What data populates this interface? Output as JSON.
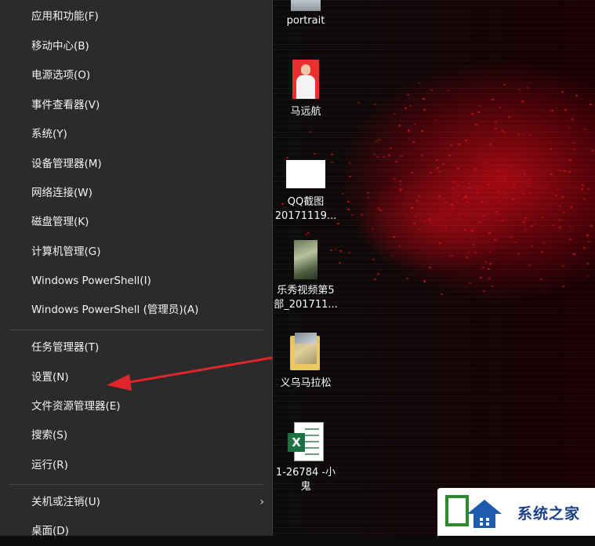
{
  "menu": {
    "items": [
      {
        "label": "应用和功能(F)"
      },
      {
        "label": "移动中心(B)"
      },
      {
        "label": "电源选项(O)"
      },
      {
        "label": "事件查看器(V)"
      },
      {
        "label": "系统(Y)"
      },
      {
        "label": "设备管理器(M)"
      },
      {
        "label": "网络连接(W)"
      },
      {
        "label": "磁盘管理(K)"
      },
      {
        "label": "计算机管理(G)"
      },
      {
        "label": "Windows PowerShell(I)"
      },
      {
        "label": "Windows PowerShell (管理员)(A)"
      },
      {
        "label": "任务管理器(T)"
      },
      {
        "label": "设置(N)"
      },
      {
        "label": "文件资源管理器(E)"
      },
      {
        "label": "搜索(S)"
      },
      {
        "label": "运行(R)"
      },
      {
        "label": "关机或注销(U)"
      },
      {
        "label": "桌面(D)"
      }
    ],
    "submenu_arrow": "›"
  },
  "desktop": {
    "icons": [
      {
        "label": "portrait"
      },
      {
        "label": "马远航"
      },
      {
        "label": "QQ截图\n20171119..."
      },
      {
        "label": "乐秀视频第5\n部_201711..."
      },
      {
        "label": "义乌马拉松"
      },
      {
        "label": "1-26784 -小\n鬼"
      }
    ],
    "excel_letter": "X"
  },
  "watermark": {
    "text": "系统之家"
  },
  "colors": {
    "menu_bg": "#2b2b2b",
    "arrow": "#e0262a",
    "accent_red": "#c8101a"
  }
}
